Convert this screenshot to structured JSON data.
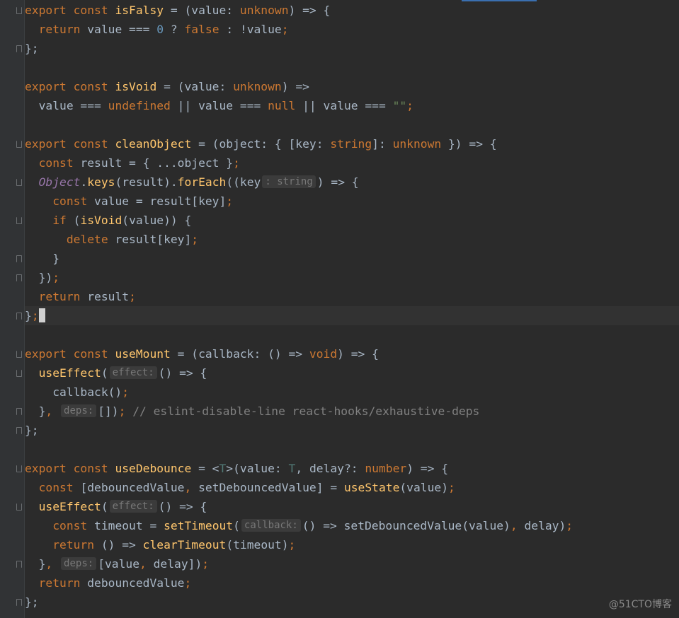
{
  "colors": {
    "keyword": "#cc7832",
    "function": "#ffc66d",
    "default": "#a9b7c6",
    "number": "#6897bb",
    "string": "#6a8759",
    "comment": "#808080",
    "objectItalic": "#9876aa",
    "typeParam": "#507874"
  },
  "editor": {
    "lines": [
      {
        "tokens": [
          [
            "export const ",
            "kw"
          ],
          [
            "isFalsy",
            "fn"
          ],
          [
            " = (value: ",
            "df"
          ],
          [
            "unknown",
            "kw"
          ],
          [
            ") => {",
            "df"
          ]
        ]
      },
      {
        "tokens": [
          [
            "  ",
            "df"
          ],
          [
            "return ",
            "kw"
          ],
          [
            "value === ",
            "df"
          ],
          [
            "0",
            "num"
          ],
          [
            " ? ",
            "df"
          ],
          [
            "false",
            "kw"
          ],
          [
            " : !value",
            "df"
          ],
          [
            ";",
            "kw"
          ]
        ]
      },
      {
        "tokens": [
          [
            "};",
            "df"
          ]
        ]
      },
      {
        "tokens": []
      },
      {
        "tokens": [
          [
            "export const ",
            "kw"
          ],
          [
            "isVoid",
            "fn"
          ],
          [
            " = (value: ",
            "df"
          ],
          [
            "unknown",
            "kw"
          ],
          [
            ") =>",
            "df"
          ]
        ]
      },
      {
        "tokens": [
          [
            "  value === ",
            "df"
          ],
          [
            "undefined",
            "kw"
          ],
          [
            " || value === ",
            "df"
          ],
          [
            "null",
            "kw"
          ],
          [
            " || value === ",
            "df"
          ],
          [
            "\"\"",
            "str"
          ],
          [
            ";",
            "kw"
          ]
        ]
      },
      {
        "tokens": []
      },
      {
        "tokens": [
          [
            "export const ",
            "kw"
          ],
          [
            "cleanObject",
            "fn"
          ],
          [
            " = (object: { [key: ",
            "df"
          ],
          [
            "string",
            "kw"
          ],
          [
            "]: ",
            "df"
          ],
          [
            "unknown",
            "kw"
          ],
          [
            " }) => {",
            "df"
          ]
        ]
      },
      {
        "tokens": [
          [
            "  ",
            "df"
          ],
          [
            "const ",
            "kw"
          ],
          [
            "result = { ...object }",
            "df"
          ],
          [
            ";",
            "kw"
          ]
        ]
      },
      {
        "tokens": [
          [
            "  ",
            "df"
          ],
          [
            "Object",
            "obj"
          ],
          [
            ".",
            "df"
          ],
          [
            "keys",
            "fn"
          ],
          [
            "(result).",
            "df"
          ],
          [
            "forEach",
            "fn"
          ],
          [
            "((key",
            "df"
          ],
          [
            ": string",
            "hint"
          ],
          [
            ") => {",
            "df"
          ]
        ]
      },
      {
        "tokens": [
          [
            "    ",
            "df"
          ],
          [
            "const ",
            "kw"
          ],
          [
            "value = result[key]",
            "df"
          ],
          [
            ";",
            "kw"
          ]
        ]
      },
      {
        "tokens": [
          [
            "    ",
            "df"
          ],
          [
            "if ",
            "kw"
          ],
          [
            "(",
            "df"
          ],
          [
            "isVoid",
            "fn"
          ],
          [
            "(value)) {",
            "df"
          ]
        ]
      },
      {
        "tokens": [
          [
            "      ",
            "df"
          ],
          [
            "delete ",
            "kw"
          ],
          [
            "result[key]",
            "df"
          ],
          [
            ";",
            "kw"
          ]
        ]
      },
      {
        "tokens": [
          [
            "    }",
            "df"
          ]
        ]
      },
      {
        "tokens": [
          [
            "  })",
            "df"
          ],
          [
            ";",
            "kw"
          ]
        ]
      },
      {
        "tokens": [
          [
            "  ",
            "df"
          ],
          [
            "return ",
            "kw"
          ],
          [
            "result",
            "df"
          ],
          [
            ";",
            "kw"
          ]
        ]
      },
      {
        "tokens": [
          [
            "}",
            "df"
          ],
          [
            ";",
            "kw"
          ],
          [
            "",
            "caret"
          ]
        ]
      },
      {
        "tokens": []
      },
      {
        "tokens": [
          [
            "export const ",
            "kw"
          ],
          [
            "useMount",
            "fn"
          ],
          [
            " = (callback: () => ",
            "df"
          ],
          [
            "void",
            "kw"
          ],
          [
            ") => {",
            "df"
          ]
        ]
      },
      {
        "tokens": [
          [
            "  ",
            "df"
          ],
          [
            "useEffect",
            "fn"
          ],
          [
            "(",
            "df"
          ],
          [
            "effect:",
            "hint"
          ],
          [
            "() => {",
            "df"
          ]
        ]
      },
      {
        "tokens": [
          [
            "    callback()",
            "df"
          ],
          [
            ";",
            "kw"
          ]
        ]
      },
      {
        "tokens": [
          [
            "  }",
            "df"
          ],
          [
            ", ",
            "kw"
          ],
          [
            "deps:",
            "hint"
          ],
          [
            "[])",
            "df"
          ],
          [
            ";",
            "kw"
          ],
          [
            " // eslint-disable-line react-hooks/exhaustive-deps",
            "cm"
          ]
        ]
      },
      {
        "tokens": [
          [
            "};",
            "df"
          ]
        ]
      },
      {
        "tokens": []
      },
      {
        "tokens": [
          [
            "export const ",
            "kw"
          ],
          [
            "useDebounce",
            "fn"
          ],
          [
            " = <",
            "df"
          ],
          [
            "T",
            "tp"
          ],
          [
            ">(value: ",
            "df"
          ],
          [
            "T",
            "tp"
          ],
          [
            ", delay?: ",
            "df"
          ],
          [
            "number",
            "kw"
          ],
          [
            ") => {",
            "df"
          ]
        ]
      },
      {
        "tokens": [
          [
            "  ",
            "df"
          ],
          [
            "const ",
            "kw"
          ],
          [
            "[debouncedValue",
            "df"
          ],
          [
            ", ",
            "kw"
          ],
          [
            "setDebouncedValue] = ",
            "df"
          ],
          [
            "useState",
            "fn"
          ],
          [
            "(value)",
            "df"
          ],
          [
            ";",
            "kw"
          ]
        ]
      },
      {
        "tokens": [
          [
            "  ",
            "df"
          ],
          [
            "useEffect",
            "fn"
          ],
          [
            "(",
            "df"
          ],
          [
            "effect:",
            "hint"
          ],
          [
            "() => {",
            "df"
          ]
        ]
      },
      {
        "tokens": [
          [
            "    ",
            "df"
          ],
          [
            "const ",
            "kw"
          ],
          [
            "timeout = ",
            "df"
          ],
          [
            "setTimeout",
            "fn"
          ],
          [
            "(",
            "df"
          ],
          [
            "callback:",
            "hint"
          ],
          [
            "() => setDebouncedValue(value)",
            "df"
          ],
          [
            ", ",
            "kw"
          ],
          [
            "delay)",
            "df"
          ],
          [
            ";",
            "kw"
          ]
        ]
      },
      {
        "tokens": [
          [
            "    ",
            "df"
          ],
          [
            "return ",
            "kw"
          ],
          [
            "() => ",
            "df"
          ],
          [
            "clearTimeout",
            "fn"
          ],
          [
            "(timeout)",
            "df"
          ],
          [
            ";",
            "kw"
          ]
        ]
      },
      {
        "tokens": [
          [
            "  }",
            "df"
          ],
          [
            ", ",
            "kw"
          ],
          [
            "deps:",
            "hint"
          ],
          [
            "[value",
            "df"
          ],
          [
            ", ",
            "kw"
          ],
          [
            "delay])",
            "df"
          ],
          [
            ";",
            "kw"
          ]
        ]
      },
      {
        "tokens": [
          [
            "  ",
            "df"
          ],
          [
            "return ",
            "kw"
          ],
          [
            "debouncedValue",
            "df"
          ],
          [
            ";",
            "kw"
          ]
        ]
      },
      {
        "tokens": [
          [
            "};",
            "df"
          ]
        ]
      }
    ]
  },
  "watermark": "@51CTO博客"
}
